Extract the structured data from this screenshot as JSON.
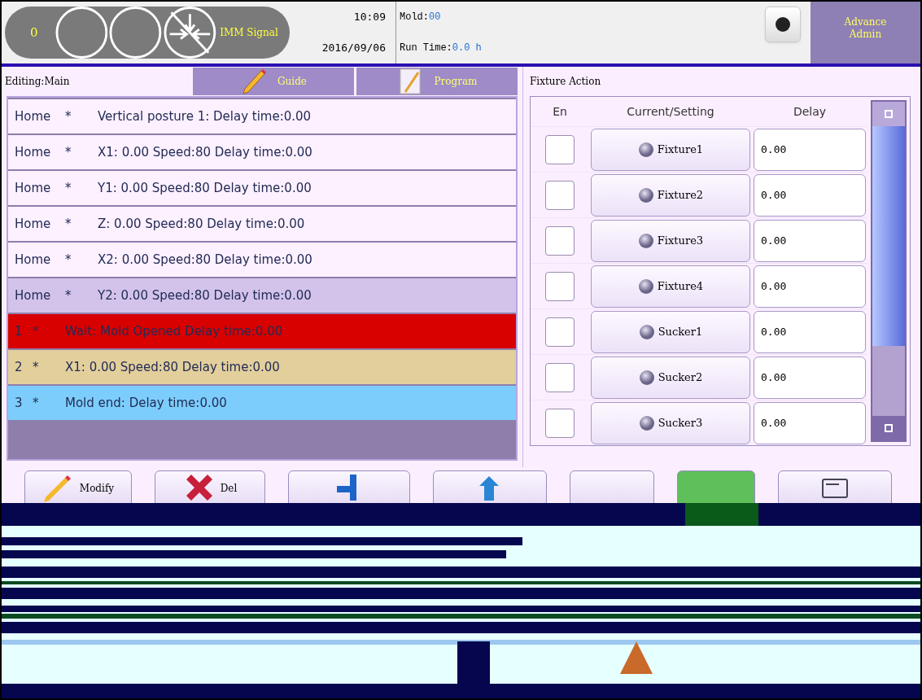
{
  "header": {
    "counter": "0",
    "signal_label": "IMM Signal",
    "time": "10:09",
    "date": "2016/09/06",
    "mold_label": "Mold:",
    "mold_value": "00",
    "run_time_label": "Run Time:",
    "run_time_value": "0.0 h",
    "user": "Advance Admin"
  },
  "editor": {
    "editing": "Editing:Main",
    "tabs": [
      {
        "label": "Guide",
        "kind": "pencil"
      },
      {
        "label": "Program",
        "kind": "notebook"
      }
    ]
  },
  "program_rows": [
    {
      "step": "Home",
      "mark": "*",
      "text": "Vertical posture 1:  Delay time:0.00",
      "color": "#fdf0ff"
    },
    {
      "step": "Home",
      "mark": "*",
      "text": "X1: 0.00 Speed:80  Delay time:0.00",
      "color": "#fdf0ff"
    },
    {
      "step": "Home",
      "mark": "*",
      "text": "Y1: 0.00 Speed:80  Delay time:0.00",
      "color": "#fdf0ff"
    },
    {
      "step": "Home",
      "mark": "*",
      "text": "Z: 0.00 Speed:80  Delay time:0.00",
      "color": "#fdf0ff"
    },
    {
      "step": "Home",
      "mark": "*",
      "text": "X2: 0.00 Speed:80  Delay time:0.00",
      "color": "#fdf0ff"
    },
    {
      "step": "Home",
      "mark": "*",
      "text": "Y2: 0.00 Speed:80  Delay time:0.00",
      "color": "#d3c3ea"
    },
    {
      "step": "1",
      "mark": "*",
      "text": "Wait: Mold Opened Delay time:0.00",
      "color": "#d90000"
    },
    {
      "step": "2",
      "mark": "*",
      "text": "X1: 0.00 Speed:80  Delay time:0.00",
      "color": "#e3cf9c"
    },
    {
      "step": "3",
      "mark": "*",
      "text": "Mold end:  Delay time:0.00",
      "color": "#7ccdfb"
    }
  ],
  "fixture_panel": {
    "title": "Fixture Action",
    "columns": [
      "En",
      "Current/Setting",
      "Delay"
    ],
    "rows": [
      {
        "enabled": false,
        "name": "Fixture1",
        "delay": "0.00"
      },
      {
        "enabled": false,
        "name": "Fixture2",
        "delay": "0.00"
      },
      {
        "enabled": false,
        "name": "Fixture3",
        "delay": "0.00"
      },
      {
        "enabled": false,
        "name": "Fixture4",
        "delay": "0.00"
      },
      {
        "enabled": false,
        "name": "Sucker1",
        "delay": "0.00"
      },
      {
        "enabled": false,
        "name": "Sucker2",
        "delay": "0.00"
      },
      {
        "enabled": false,
        "name": "Sucker3",
        "delay": "0.00"
      }
    ]
  },
  "buttons": [
    {
      "label": "Modify",
      "kind": "pencil"
    },
    {
      "label": "Del",
      "kind": "cross"
    },
    {
      "kind": "insert"
    },
    {
      "kind": "up"
    },
    {
      "kind": "blank"
    },
    {
      "kind": "green"
    },
    {
      "kind": "card"
    }
  ]
}
